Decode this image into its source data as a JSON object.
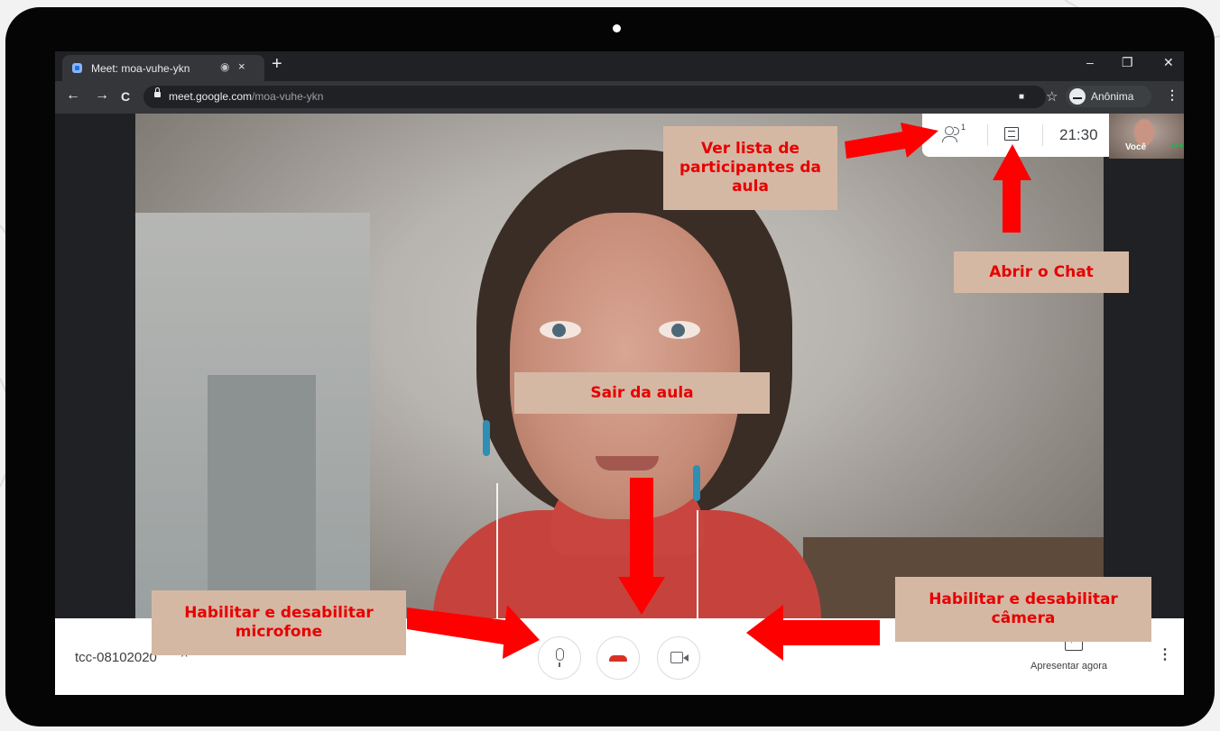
{
  "browser": {
    "tab_title": "Meet: moa-vuhe-ykn",
    "tab_close": "×",
    "tab_rec": "◉",
    "new_tab": "+",
    "win_min": "–",
    "win_restore": "❐",
    "win_close": "✕",
    "back": "←",
    "forward": "→",
    "reload": "C",
    "url_host": "meet.google.com",
    "url_path": "/moa-vuhe-ykn",
    "cam_indicator": "■",
    "star": "☆",
    "profile_label": "Anônima",
    "menu": "⋮"
  },
  "meet": {
    "participant_count": "1",
    "time": "21:30",
    "self_label": "Você",
    "self_dots": "•••",
    "meeting_code": "tcc-08102020",
    "chevron_up": "^",
    "present_label": "Apresentar agora",
    "more_menu": "⋮"
  },
  "annotations": {
    "participants": "Ver lista de participantes da aula",
    "chat": "Abrir o Chat",
    "leave": "Sair da aula",
    "mic": "Habilitar e desabilitar microfone",
    "camera": "Habilitar e desabilitar câmera"
  },
  "colors": {
    "annotation_bg": "#d5b8a4",
    "annotation_text": "#e60000",
    "arrow": "#ff0000",
    "hangup": "#d93025"
  }
}
